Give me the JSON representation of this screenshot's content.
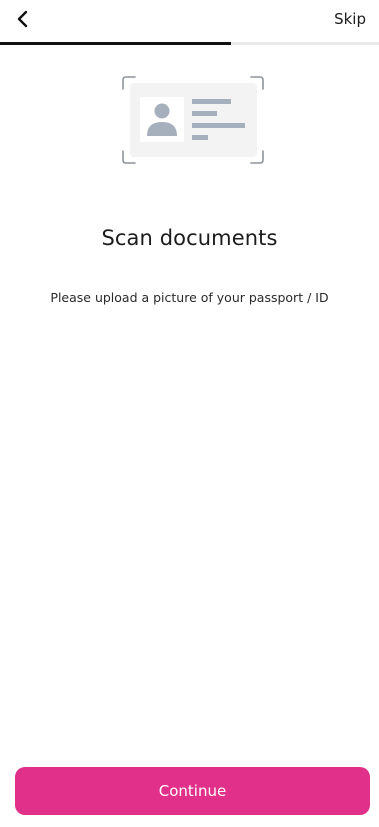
{
  "header": {
    "back_icon": "chevron-left-icon",
    "skip_label": "Skip"
  },
  "progress": {
    "fraction": 0.61
  },
  "illustration": {
    "icon": "id-card-scan-icon"
  },
  "main": {
    "title": "Scan documents",
    "subtitle": "Please upload a picture of your passport / ID"
  },
  "footer": {
    "continue_label": "Continue"
  },
  "colors": {
    "accent": "#e0308a",
    "progress": "#111111",
    "track": "#ebebeb",
    "icon_gray": "#a6b0bd"
  }
}
